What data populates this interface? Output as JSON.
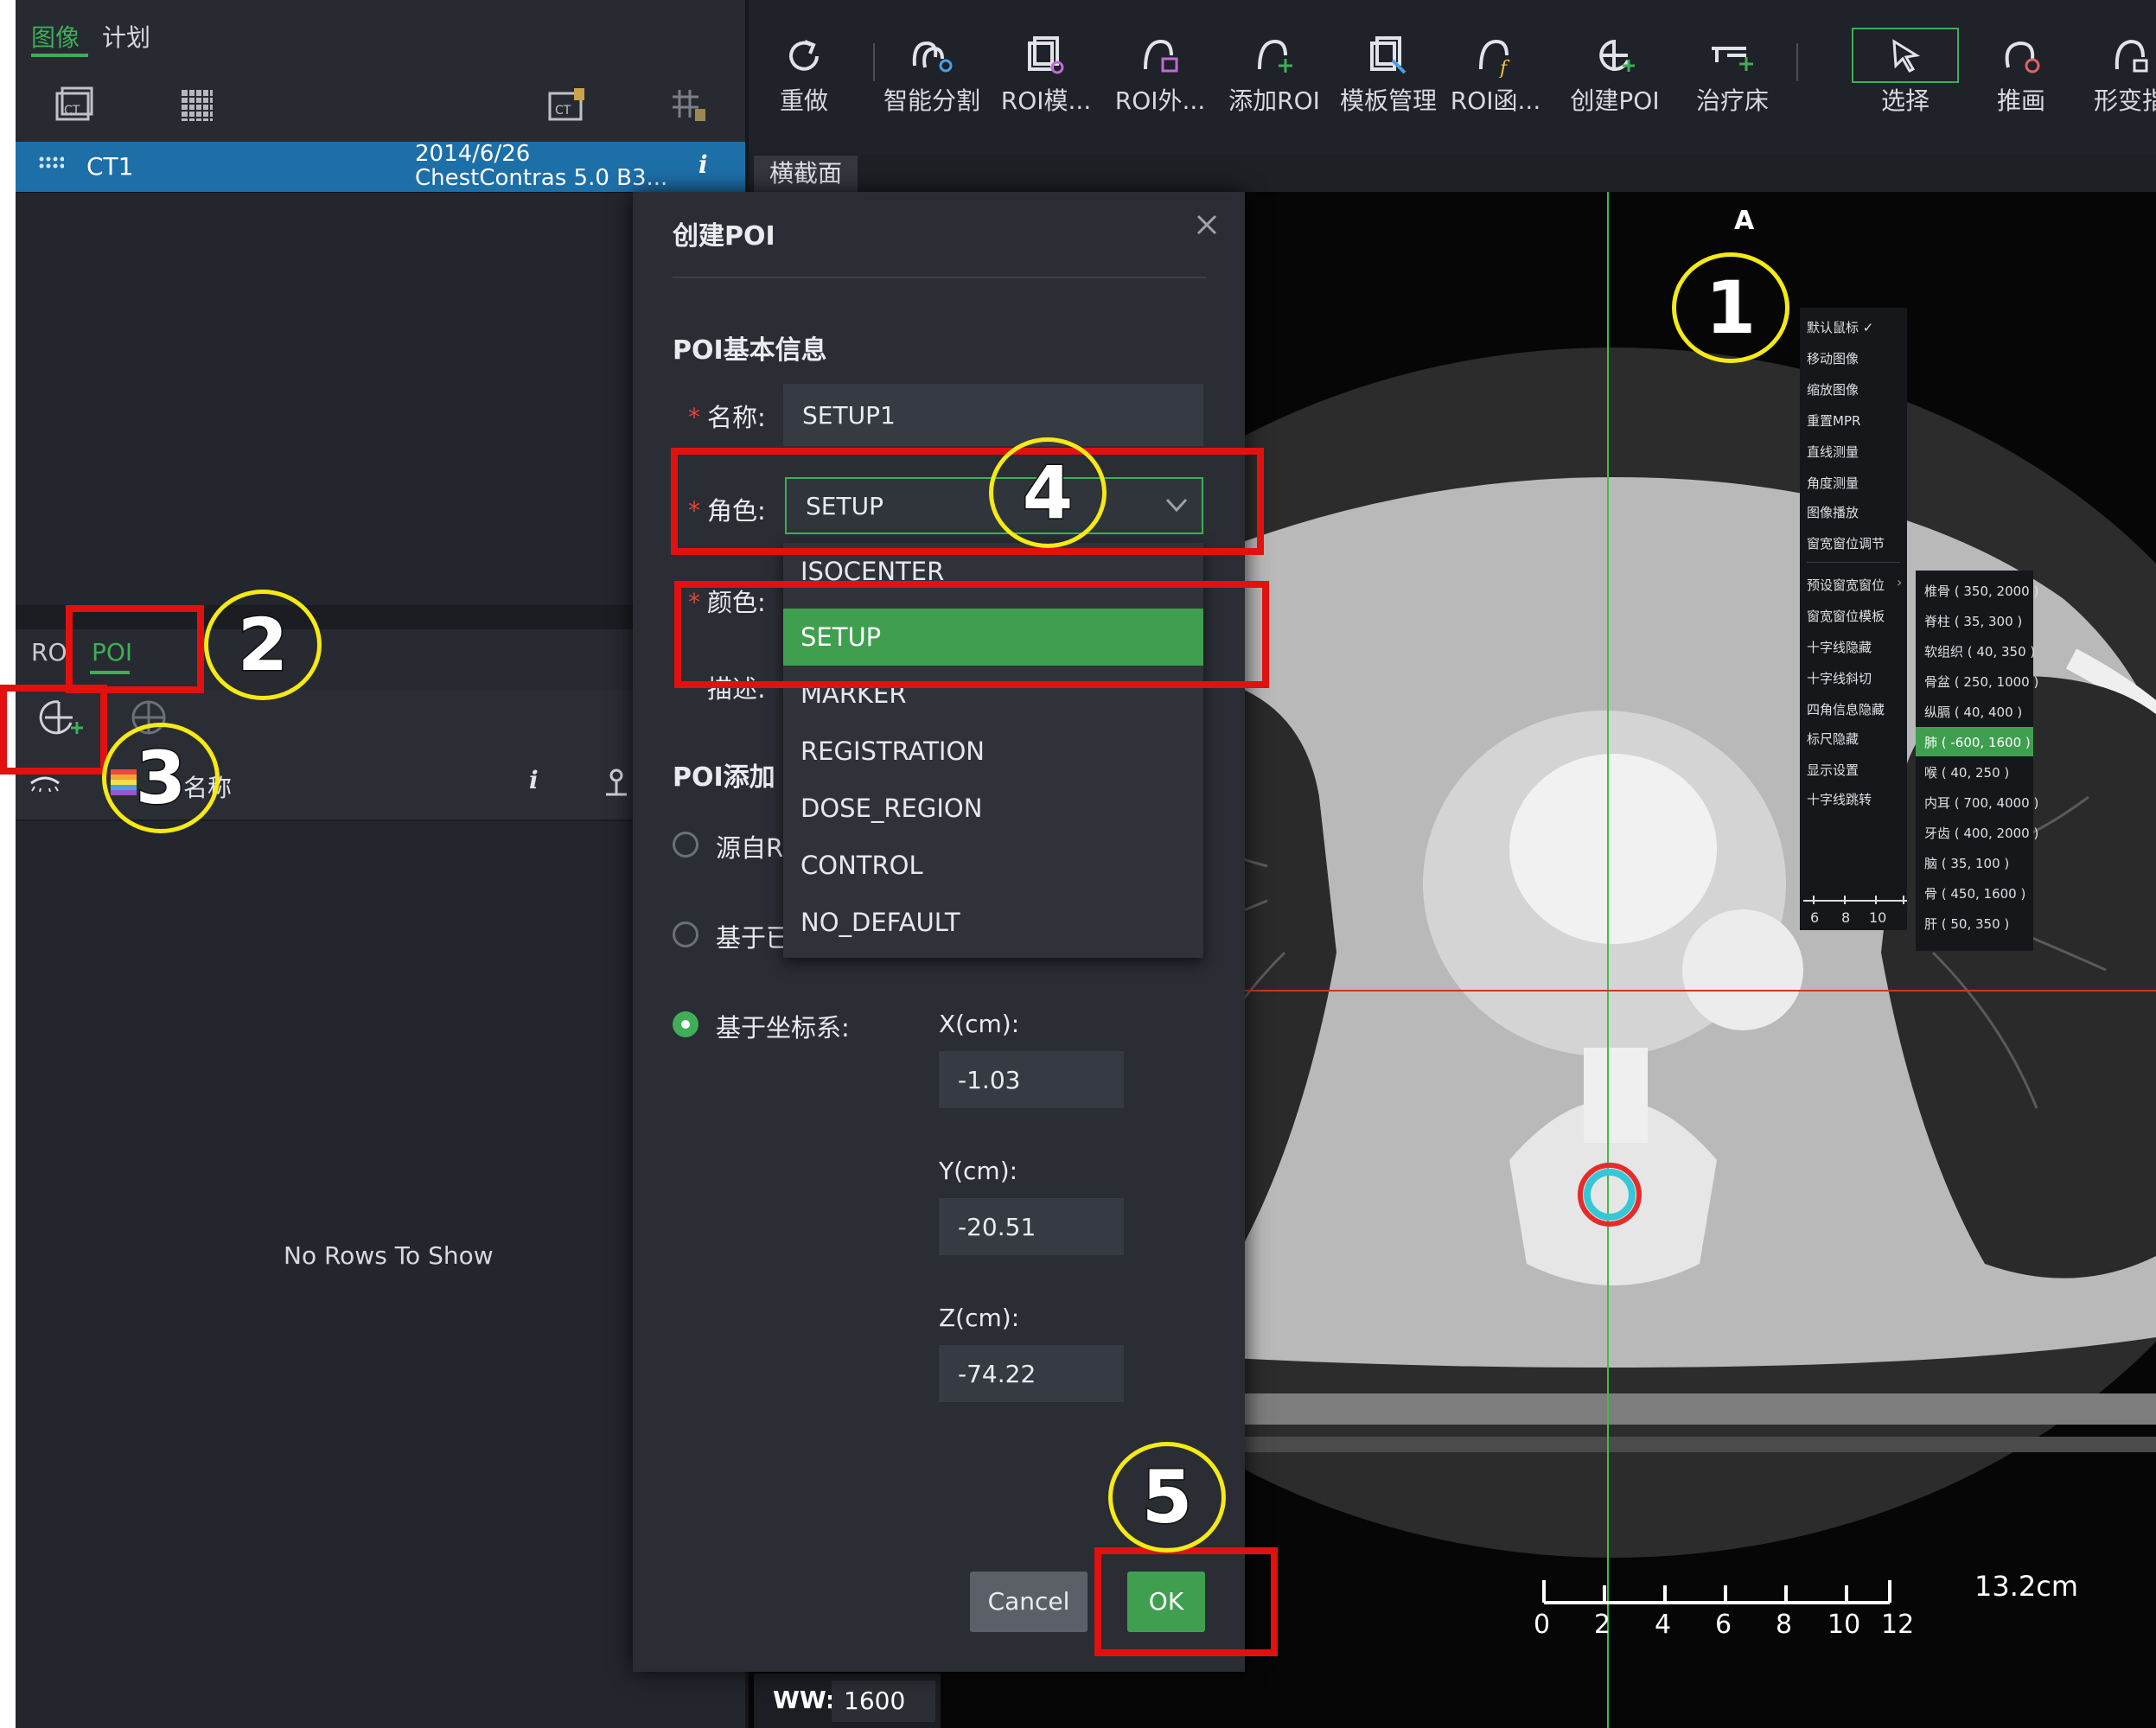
{
  "left_panel": {
    "tabs": [
      "图像",
      "计划"
    ],
    "series_name": "CT1",
    "series_date": "2014/6/26",
    "series_desc": "ChestContras 5.0 B3...",
    "info_glyph": "i",
    "sub_tabs": [
      "ROI",
      "POI"
    ],
    "table_header": "名称",
    "empty_text": "No Rows To Show"
  },
  "toolbar": {
    "items": [
      "重做",
      "智能分割",
      "ROI模...",
      "ROI外...",
      "添加ROI",
      "模板管理",
      "ROI函...",
      "创建POI",
      "治疗床",
      "选择",
      "推画",
      "形变指"
    ]
  },
  "viewer": {
    "tab_label": "横截面",
    "orientation_label": "A",
    "scale_label": "13.2cm",
    "scale_ticks": [
      "0",
      "2",
      "4",
      "6",
      "8",
      "10",
      "12"
    ],
    "ww_label": "WW:",
    "ww_value": "1600"
  },
  "context_menu": {
    "items": [
      "默认鼠标 ✓",
      "移动图像",
      "缩放图像",
      "重置MPR",
      "直线测量",
      "角度测量",
      "图像播放",
      "窗宽窗位调节",
      "预设窗宽窗位",
      "窗宽窗位模板",
      "十字线隐藏",
      "十字线斜切",
      "四角信息隐藏",
      "标尺隐藏",
      "显示设置",
      "十字线跳转"
    ],
    "ruler_ticks": [
      "6",
      "8",
      "10"
    ]
  },
  "window_presets": {
    "items": [
      "椎骨 ( 350, 2000 )",
      "脊柱 ( 35, 300 )",
      "软组织 ( 40, 350 )",
      "骨盆 ( 250, 1000 )",
      "纵膈 ( 40, 400 )",
      "肺 ( -600, 1600 )",
      "喉 ( 40, 250 )",
      "内耳 ( 700, 4000 )",
      "牙齿 ( 400, 2000 )",
      "脑 ( 35, 100 )",
      "骨 ( 450, 1600 )",
      "肝 ( 50, 350 )"
    ],
    "selected_index": 5
  },
  "dialog": {
    "title": "创建POI",
    "section_title": "POI基本信息",
    "name_label": "名称:",
    "name_value": "SETUP1",
    "role_label": "角色:",
    "role_value": "SETUP",
    "color_label": "颜色:",
    "desc_label": "描述:",
    "add_section": "POI添加",
    "radio_options": [
      "源自R",
      "基于已",
      "基于坐标系:"
    ],
    "selected_radio": 2,
    "x_label": "X(cm):",
    "x_value": "-1.03",
    "y_label": "Y(cm):",
    "y_value": "-20.51",
    "z_label": "Z(cm):",
    "z_value": "-74.22",
    "cancel_label": "Cancel",
    "ok_label": "OK"
  },
  "role_dropdown": {
    "options": [
      "ISOCENTER",
      "SETUP",
      "MARKER",
      "REGISTRATION",
      "DOSE_REGION",
      "CONTROL",
      "NO_DEFAULT"
    ],
    "selected_index": 1
  },
  "annotations": [
    "1",
    "2",
    "3",
    "4",
    "5"
  ],
  "colors": {
    "accent_green": "#3f9f4f",
    "annotation_red": "#e31010",
    "annotation_yellow": "#f5ea14",
    "selected_blue": "#1d6fa8"
  }
}
